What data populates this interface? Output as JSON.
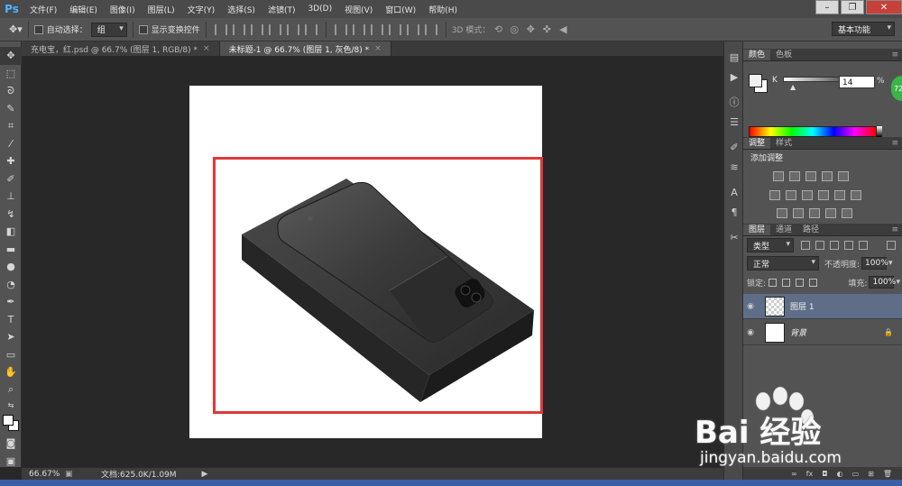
{
  "app": {
    "logo": "Ps"
  },
  "menu": [
    "文件(F)",
    "编辑(E)",
    "图像(I)",
    "图层(L)",
    "文字(Y)",
    "选择(S)",
    "滤镜(T)",
    "3D(D)",
    "视图(V)",
    "窗口(W)",
    "帮助(H)"
  ],
  "window_controls": {
    "minimize": "–",
    "restore": "❐",
    "close": "✕"
  },
  "options": {
    "auto_select_label": "自动选择：",
    "auto_select_value": "组",
    "show_transform_label": "显示变换控件",
    "mode3d_label": "3D 模式：",
    "workspace": "基本功能"
  },
  "tabs": [
    {
      "label": "充电宝，红.psd @ 66.7% (图层 1, RGB/8) *"
    },
    {
      "label": "未标题-1 @ 66.7% (图层 1, 灰色/8) *"
    }
  ],
  "status": {
    "zoom": "66.67%",
    "doc": "文档:625.0K/1.09M"
  },
  "color_panel": {
    "tabs": [
      "颜色",
      "色板"
    ],
    "channel": "K",
    "value": "14",
    "unit": "%",
    "badge": "72"
  },
  "adjust_panel": {
    "tabs": [
      "调整",
      "样式"
    ],
    "title": "添加调整"
  },
  "layers_panel": {
    "tabs": [
      "图层",
      "通道",
      "路径"
    ],
    "filter": "类型",
    "blend_mode": "正常",
    "opacity_label": "不透明度:",
    "opacity": "100%",
    "lock_label": "锁定:",
    "fill_label": "填充:",
    "fill": "100%",
    "layers": [
      {
        "name": "图层 1"
      },
      {
        "name": "背景"
      }
    ]
  },
  "watermark": {
    "brand": "Bai 经验",
    "url": "jingyan.baidu.com"
  },
  "colors": {
    "selection": "#e0383a",
    "ps_blue": "#4fb3ff"
  }
}
